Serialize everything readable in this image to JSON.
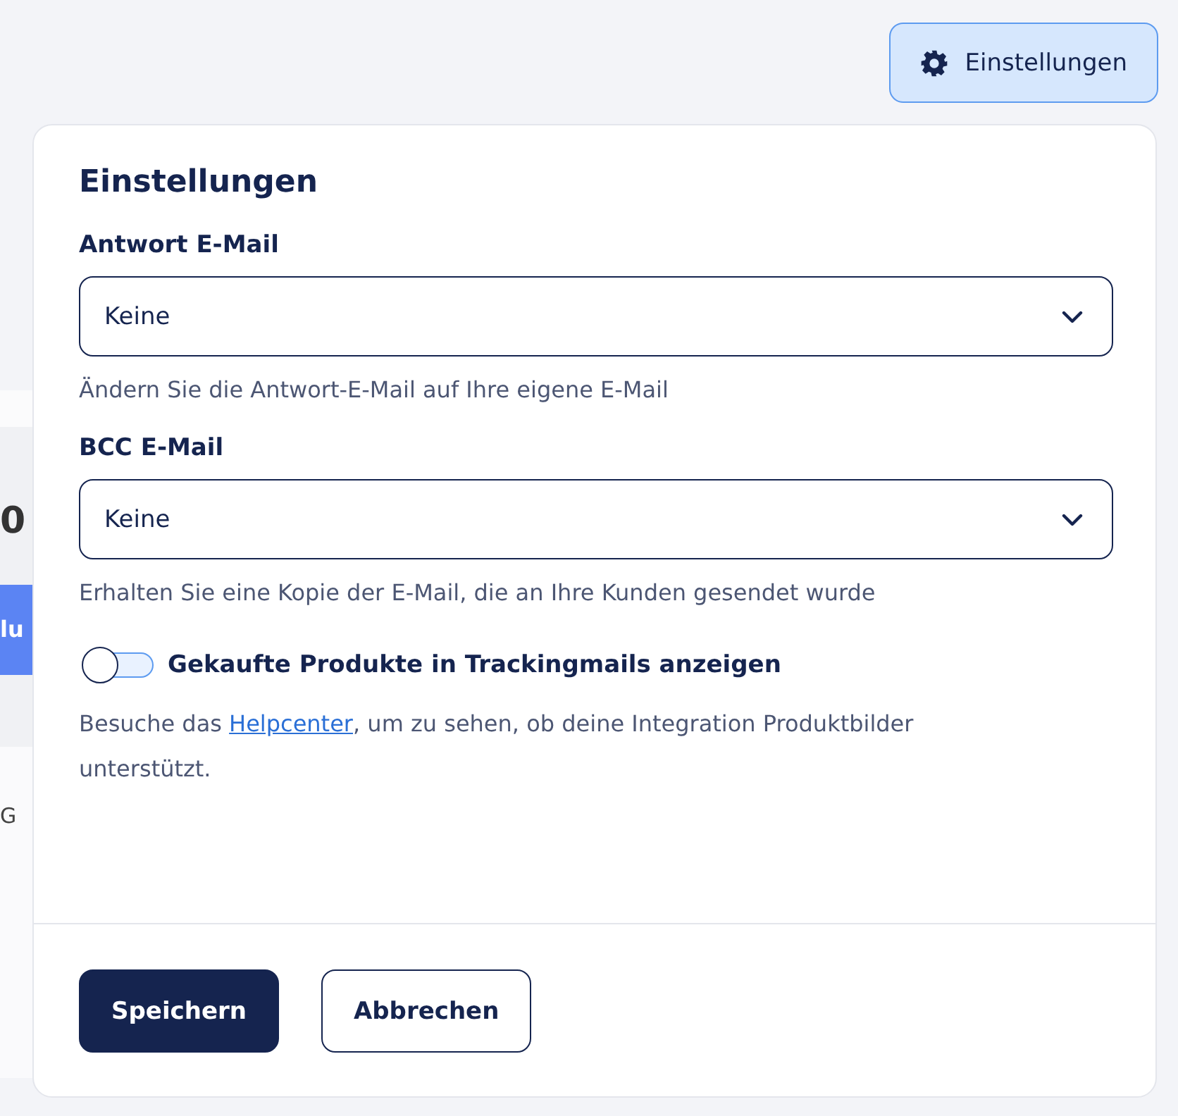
{
  "header_button": {
    "label": "Einstellungen"
  },
  "background_fragments": [
    {
      "kind": "heading",
      "text": "0"
    },
    {
      "kind": "button",
      "text": "lu"
    },
    {
      "kind": "text",
      "text": "G"
    }
  ],
  "panel": {
    "title": "Einstellungen",
    "fields": [
      {
        "label": "Antwort E-Mail",
        "value": "Keine",
        "hint": "Ändern Sie die Antwort-E-Mail auf Ihre eigene E-Mail"
      },
      {
        "label": "BCC E-Mail",
        "value": "Keine",
        "hint": "Erhalten Sie eine Kopie der E-Mail, die an Ihre Kunden gesendet wurde"
      }
    ],
    "toggle": {
      "label": "Gekaufte Produkte in Trackingmails anzeigen",
      "on": false
    },
    "note": {
      "before": "Besuche das ",
      "link": "Helpcenter",
      "after": ", um zu sehen, ob deine Integration Produktbilder unterstützt."
    },
    "buttons": [
      {
        "label": "Speichern",
        "kind": "primary"
      },
      {
        "label": "Abbrechen",
        "kind": "secondary"
      }
    ]
  }
}
